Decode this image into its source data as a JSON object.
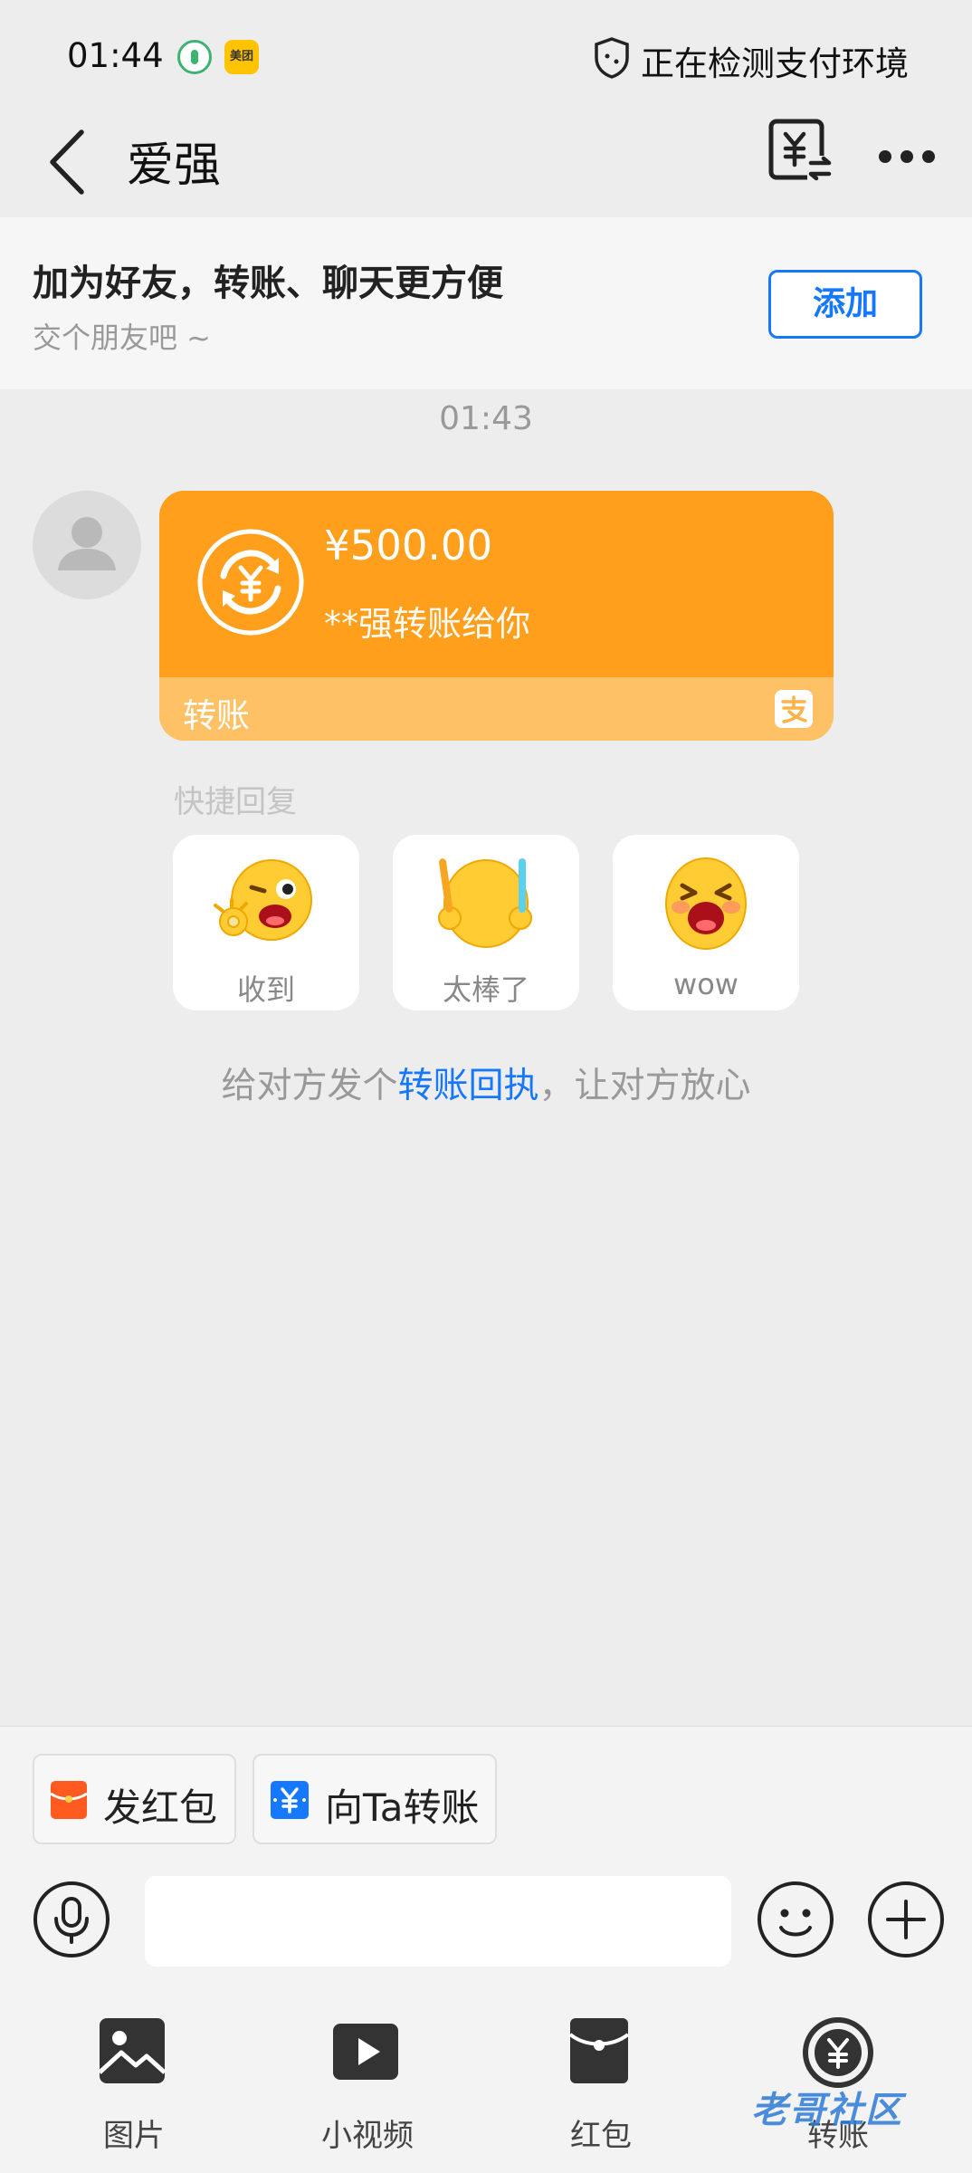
{
  "status_bar": {
    "time": "01:44",
    "app_badge_2": "美团",
    "status_text": "正在检测支付环境"
  },
  "nav": {
    "title": "爱强"
  },
  "banner": {
    "title": "加为好友，转账、聊天更方便",
    "subtitle": "交个朋友吧 ~",
    "add_label": "添加"
  },
  "chat": {
    "timestamp": "01:43",
    "transfer": {
      "amount": "¥500.00",
      "description": "**强转账给你",
      "label": "转账"
    },
    "quick_reply_label": "快捷回复",
    "quick_replies": [
      {
        "label": "收到",
        "icon": "ok-wink-emoji-icon"
      },
      {
        "label": "太棒了",
        "icon": "glowsticks-emoji-icon"
      },
      {
        "label": "wow",
        "icon": "wow-emoji-icon"
      }
    ],
    "receipt_prefix": "给对方发个",
    "receipt_link": "转账回执",
    "receipt_suffix": "，让对方放心"
  },
  "bottom": {
    "chip_red_packet": "发红包",
    "chip_transfer": "向Ta转账",
    "input_value": "",
    "tools": [
      {
        "label": "图片",
        "icon": "image-icon"
      },
      {
        "label": "小视频",
        "icon": "video-icon"
      },
      {
        "label": "红包",
        "icon": "red-packet-icon"
      },
      {
        "label": "转账",
        "icon": "transfer-icon"
      }
    ]
  },
  "watermark": "老哥社区",
  "colors": {
    "accent_blue": "#1677ff",
    "transfer_orange": "#ff9f1c",
    "transfer_orange_light": "#ffc165",
    "background": "#ededed"
  }
}
